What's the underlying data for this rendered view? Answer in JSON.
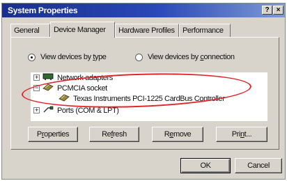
{
  "window": {
    "title": "System Properties",
    "help_glyph": "?",
    "close_glyph": "×"
  },
  "tabs": [
    {
      "label": "General"
    },
    {
      "label": "Device Manager",
      "active": true
    },
    {
      "label": "Hardware Profiles"
    },
    {
      "label": "Performance"
    }
  ],
  "view": {
    "by_type": {
      "pre": "View devices by ",
      "acc": "t",
      "post": "ype",
      "selected": true
    },
    "by_connection": {
      "pre": "View devices by ",
      "acc": "c",
      "post": "onnection",
      "selected": false
    }
  },
  "tree": [
    {
      "label": "Network adapters",
      "expand": "+",
      "icon": "network-adapter-icon"
    },
    {
      "label": "PCMCIA socket",
      "expand": "−",
      "icon": "pcmcia-socket-icon"
    },
    {
      "label": "Texas Instruments PCI-1225 CardBus Controller",
      "icon": "pcmcia-device-icon"
    },
    {
      "label": "Ports (COM & LPT)",
      "expand": "+",
      "icon": "port-icon"
    }
  ],
  "buttons": {
    "properties": {
      "pre": "P",
      "acc": "r",
      "post": "operties"
    },
    "refresh": {
      "pre": "Re",
      "acc": "f",
      "post": "resh"
    },
    "remove": {
      "pre": "R",
      "acc": "e",
      "post": "move"
    },
    "print": {
      "pre": "Pri",
      "acc": "n",
      "post": "t..."
    },
    "ok": "OK",
    "cancel": "Cancel"
  },
  "colors": {
    "annotation": "#e0252a",
    "titlebar": "#1a2f8f"
  }
}
